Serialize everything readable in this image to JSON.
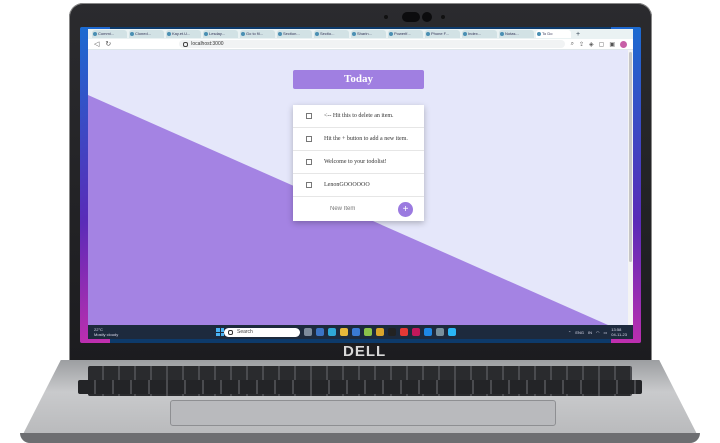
{
  "device": {
    "brand": "DELL"
  },
  "browser": {
    "tabs": [
      {
        "label": "Commi...",
        "active": false
      },
      {
        "label": "Cloned...",
        "active": false
      },
      {
        "label": "Kay.et.U...",
        "active": false
      },
      {
        "label": "Lesday...",
        "active": false
      },
      {
        "label": "Go to fil...",
        "active": false
      },
      {
        "label": "Section...",
        "active": false
      },
      {
        "label": "Sectio...",
        "active": false
      },
      {
        "label": "Sharin...",
        "active": false
      },
      {
        "label": "Powerlf...",
        "active": false
      },
      {
        "label": "Phone F...",
        "active": false
      },
      {
        "label": "Index...",
        "active": false
      },
      {
        "label": "Notas...",
        "active": false
      },
      {
        "label": "To Do",
        "active": true
      }
    ],
    "new_tab_label": "+",
    "url": "localhost:3000"
  },
  "app": {
    "title": "Today",
    "items": [
      {
        "text": "<-- Hit this to delete an item."
      },
      {
        "text": "Hit the + button to add a new item."
      },
      {
        "text": "Welcome to your todolist!"
      },
      {
        "text": "LenonGOOOOOO"
      }
    ],
    "new_item_placeholder": "New Item",
    "add_button_label": "+",
    "colors": {
      "accent": "#a07fe1",
      "background": "#e5e7fa",
      "diagonal": "#a483e3"
    }
  },
  "taskbar": {
    "weather_temp": "22°C",
    "weather_desc": "Mostly cloudy",
    "search_placeholder": "Search",
    "tray_lang": "ENG",
    "tray_region": "IN",
    "time": "13:58",
    "date": "04-11-23"
  }
}
